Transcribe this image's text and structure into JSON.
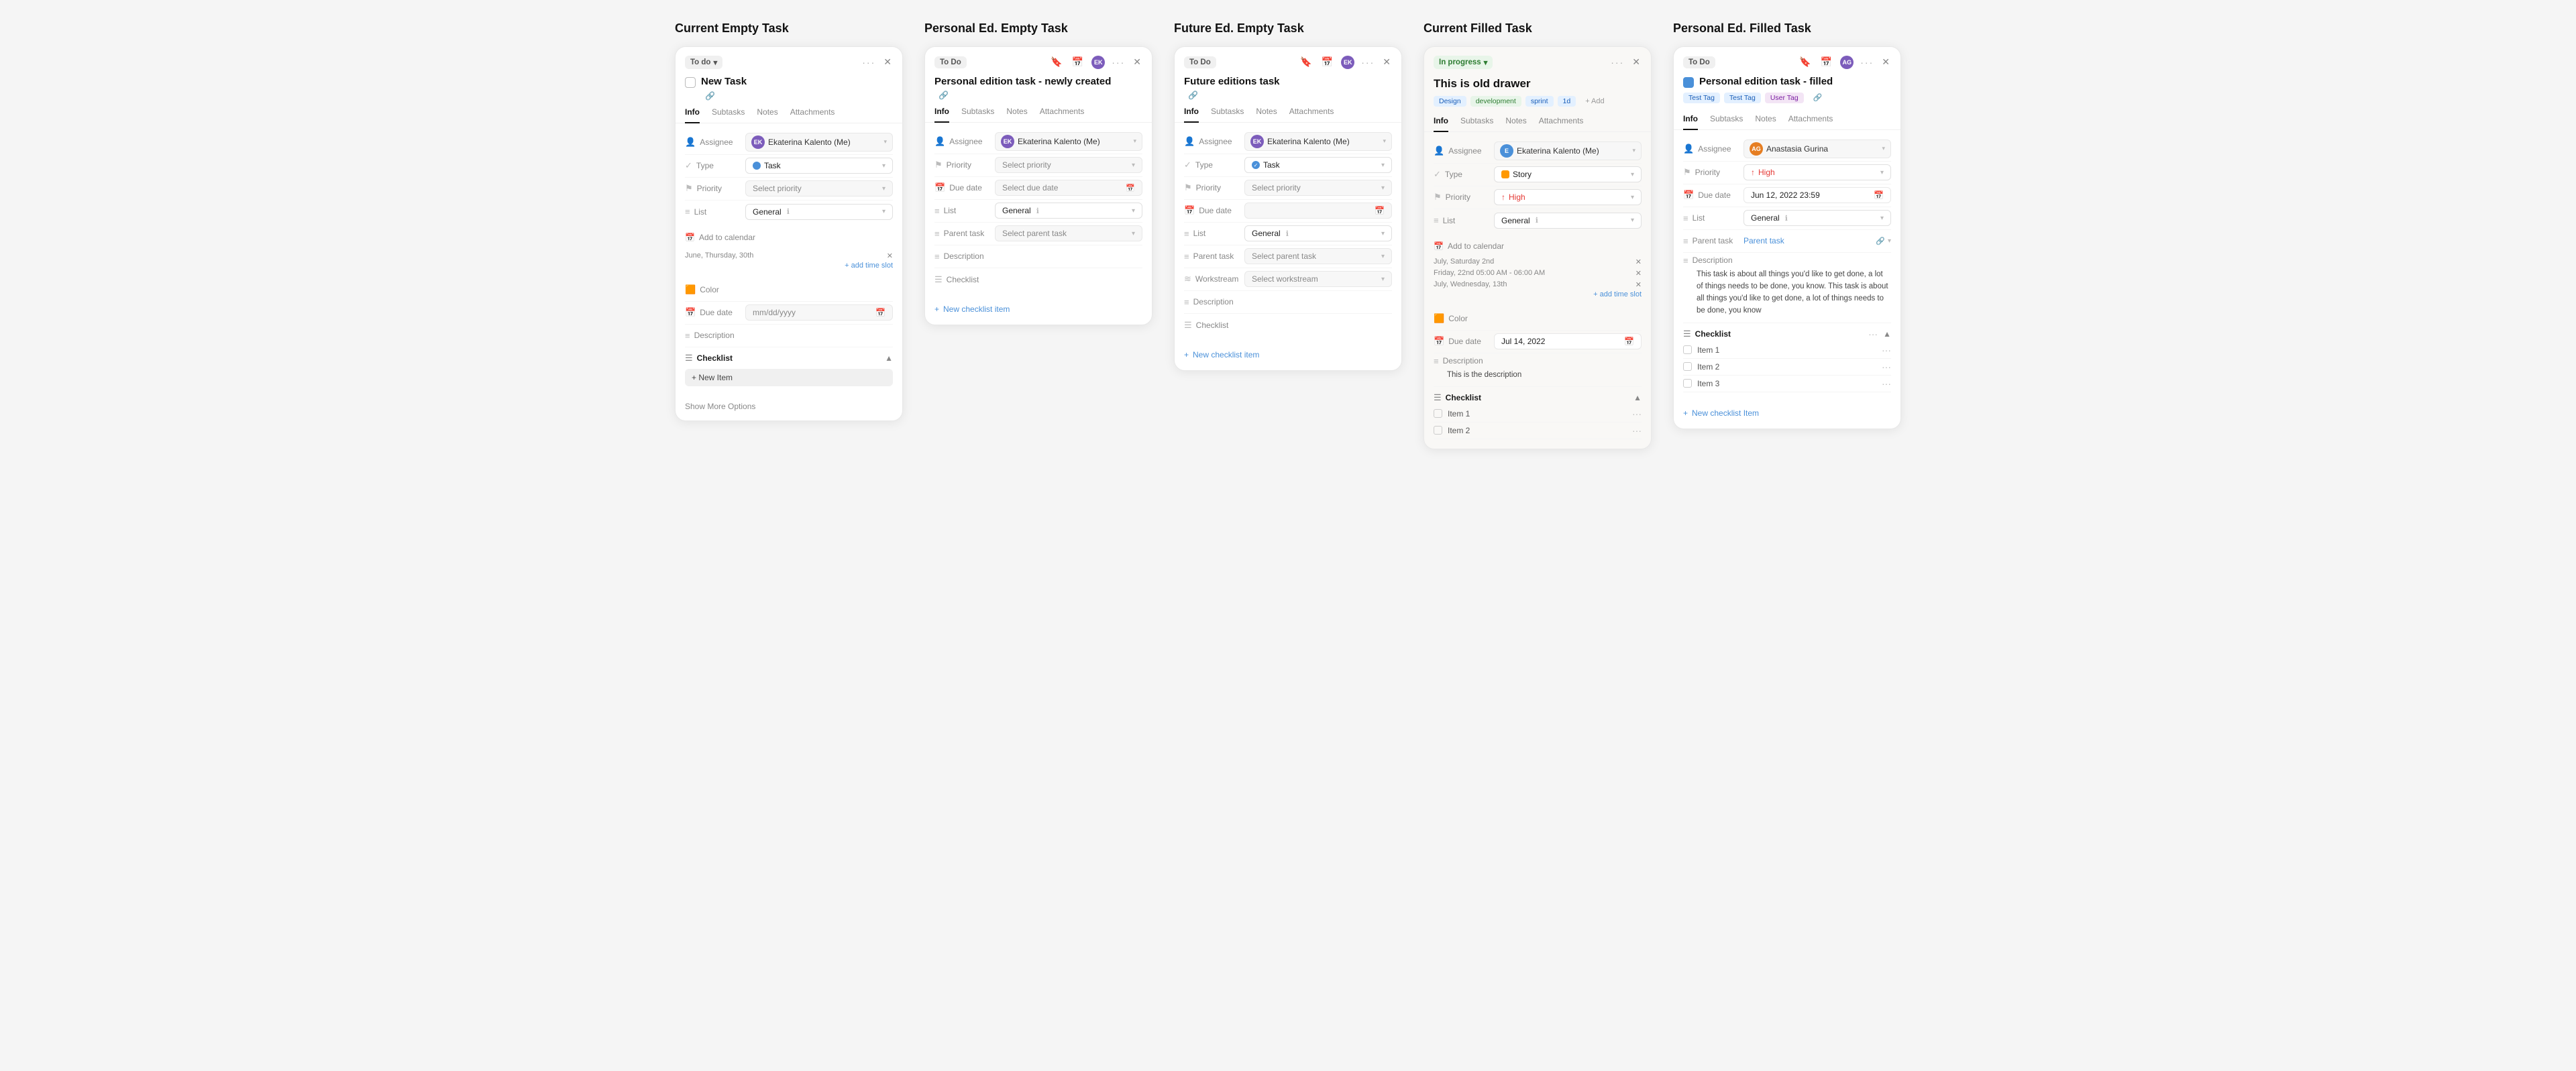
{
  "panels": [
    {
      "id": "current-empty",
      "title": "Current Empty Task",
      "header": {
        "status": "To do",
        "status_type": "todo",
        "status_chevron": "▾",
        "actions": [
          "bookmark",
          "calendar",
          "dots",
          "close"
        ],
        "show_avatar": false
      },
      "task_title": "New Task",
      "task_title_icon": "🔗",
      "tabs": [
        "Info",
        "Subtasks",
        "Notes",
        "Attachments"
      ],
      "active_tab": "Info",
      "fields": [
        {
          "label": "Assignee",
          "icon": "👤",
          "value": "Ekaterina Kalento (Me)",
          "type": "assignee",
          "avatar_color": "#7c5cbb"
        },
        {
          "label": "Type",
          "icon": "✓",
          "value": "Task",
          "type": "type",
          "dot_color": "#4a90d9"
        },
        {
          "label": "Priority",
          "icon": "⚑",
          "value": "Select priority",
          "type": "select-empty"
        },
        {
          "label": "List",
          "icon": "≡",
          "value": "General",
          "type": "list"
        }
      ],
      "show_add_calendar": true,
      "date_section": {
        "show": true,
        "note": "June, Thursday, 30th ✕",
        "add_slot": "+ add time slot"
      },
      "color_row": true,
      "due_date_row": {
        "show": true,
        "placeholder": "mm/dd/yyyy"
      },
      "description_row": true,
      "checklist": {
        "show": true,
        "expanded": true,
        "items": [],
        "new_item": "New Item",
        "show_new_item_filled": true
      },
      "show_more": "Show More Options"
    },
    {
      "id": "personal-empty",
      "title": "Personal Ed. Empty Task",
      "header": {
        "status": "To Do",
        "status_type": "todo",
        "actions": [
          "bookmark",
          "calendar",
          "avatar",
          "dots",
          "close"
        ],
        "show_avatar": true,
        "avatar_color": "#7c5cbb"
      },
      "task_title": "Personal edition task - newly created",
      "task_title_icon": "🔗",
      "tabs": [
        "Info",
        "Subtasks",
        "Notes",
        "Attachments"
      ],
      "active_tab": "Info",
      "fields": [
        {
          "label": "Assignee",
          "icon": "👤",
          "value": "Ekaterina Kalento (Me)",
          "type": "assignee",
          "avatar_color": "#7c5cbb"
        },
        {
          "label": "Priority",
          "icon": "⚑",
          "value": "Select priority",
          "type": "select-empty"
        },
        {
          "label": "Due date",
          "icon": "📅",
          "value": "Select due date",
          "type": "select-empty"
        },
        {
          "label": "List",
          "icon": "≡",
          "value": "General",
          "type": "list"
        },
        {
          "label": "Parent task",
          "icon": "≡",
          "value": "Select parent task",
          "type": "select-empty"
        }
      ],
      "description_row": true,
      "checklist": {
        "show": true,
        "expanded": false,
        "items": [],
        "new_item_label": "New checklist item",
        "show_new_item_filled": false
      }
    },
    {
      "id": "future-empty",
      "title": "Future Ed. Empty Task",
      "header": {
        "status": "To Do",
        "status_type": "todo",
        "actions": [
          "bookmark",
          "calendar",
          "avatar",
          "dots",
          "close"
        ],
        "show_avatar": true,
        "avatar_color": "#7c5cbb"
      },
      "task_title": "Future editions task",
      "task_title_icon": "🔗",
      "tabs": [
        "Info",
        "Subtasks",
        "Notes",
        "Attachments"
      ],
      "active_tab": "Info",
      "fields": [
        {
          "label": "Assignee",
          "icon": "👤",
          "value": "Ekaterina Kalento (Me)",
          "type": "assignee",
          "avatar_color": "#7c5cbb"
        },
        {
          "label": "Type",
          "icon": "✓",
          "value": "Task",
          "type": "type-checked",
          "dot_color": "#4a90d9"
        },
        {
          "label": "Priority",
          "icon": "⚑",
          "value": "Select priority",
          "type": "select-empty"
        },
        {
          "label": "Due date",
          "icon": "📅",
          "value": "",
          "type": "date-empty"
        },
        {
          "label": "List",
          "icon": "≡",
          "value": "General",
          "type": "list"
        },
        {
          "label": "Parent task",
          "icon": "≡",
          "value": "Select parent task",
          "type": "select-empty"
        },
        {
          "label": "Workstream",
          "icon": "≋",
          "value": "Select workstream",
          "type": "select-empty"
        }
      ],
      "description_row": true,
      "checklist": {
        "show": true,
        "expanded": false,
        "items": [],
        "new_item_label": "New checklist item",
        "show_new_item_filled": false
      }
    },
    {
      "id": "current-filled",
      "title": "Current Filled Task",
      "header": {
        "status": "In progress",
        "status_type": "inprogress",
        "status_chevron": "▾",
        "actions": [
          "dots",
          "close"
        ],
        "show_avatar": false
      },
      "drawer_title": "This is old drawer",
      "tags": [
        {
          "label": "Design",
          "color": "blue"
        },
        {
          "label": "development",
          "color": "green"
        },
        {
          "label": "sprint",
          "color": "blue"
        },
        {
          "label": "1d",
          "color": "blue"
        },
        {
          "label": "+ Add",
          "color": "add"
        }
      ],
      "tabs": [
        "Info",
        "Subtasks",
        "Notes",
        "Attachments"
      ],
      "active_tab": "Info",
      "fields": [
        {
          "label": "Assignee",
          "icon": "👤",
          "value": "Ekaterina Kalento (Me)",
          "type": "assignee-e",
          "avatar_color": "#4a90d9"
        },
        {
          "label": "Type",
          "icon": "✓",
          "value": "Story",
          "type": "type-story",
          "dot_color": "#ff9800"
        },
        {
          "label": "Priority",
          "icon": "⚑",
          "value": "High",
          "type": "priority-high"
        },
        {
          "label": "List",
          "icon": "≡",
          "value": "General",
          "type": "list"
        }
      ],
      "show_add_calendar": true,
      "date_section": {
        "show": true,
        "note1": "July, Saturday 2nd ✕",
        "note2": "Friday, 22nd 05:00 AM - 06:00 AM ✕",
        "note3": "July, Wednesday, 13th ✕",
        "add_slot": "+ add time slot"
      },
      "color_row": true,
      "due_date_row": {
        "show": true,
        "value": "Jul 14, 2022",
        "has_calendar_icon": true
      },
      "description_row": true,
      "description_text": "This is the description",
      "checklist": {
        "show": true,
        "expanded": true,
        "items": [
          "Item 1",
          "Item 2"
        ]
      }
    },
    {
      "id": "personal-filled",
      "title": "Personal Ed. Filled Task",
      "header": {
        "status": "To Do",
        "status_type": "todo",
        "actions": [
          "bookmark",
          "calendar",
          "avatar",
          "dots",
          "close"
        ],
        "show_avatar": true,
        "avatar_color": "#7c5cbb"
      },
      "task_title": "Personal edition task - filled",
      "task_title_icon": "🔗",
      "tags": [
        {
          "label": "Test Tag",
          "color": "blue"
        },
        {
          "label": "Test Tag",
          "color": "blue"
        },
        {
          "label": "User Tag",
          "color": "purple"
        },
        {
          "label": "🔗",
          "color": "add"
        }
      ],
      "tabs": [
        "Info",
        "Subtasks",
        "Notes",
        "Attachments"
      ],
      "active_tab": "Info",
      "fields": [
        {
          "label": "Assignee",
          "icon": "👤",
          "value": "Anastasia Gurina",
          "type": "assignee",
          "avatar_color": "#e67e22"
        },
        {
          "label": "Priority",
          "icon": "⚑",
          "value": "High",
          "type": "priority-high"
        },
        {
          "label": "Due date",
          "icon": "📅",
          "value": "Jun 12, 2022 23:59",
          "type": "date-filled"
        },
        {
          "label": "List",
          "icon": "≡",
          "value": "General",
          "type": "list"
        },
        {
          "label": "Parent task",
          "icon": "≡",
          "value": "Parent task",
          "type": "parent-task-link"
        }
      ],
      "description_row": true,
      "description_text": "This task is about all things you'd like to get done, a lot of things needs to be done, you know. This task is about all things you'd like to get done, a lot of things needs to be done, you know",
      "checklist": {
        "show": true,
        "expanded": true,
        "items": [
          "Item 1",
          "Item 2",
          "Item 3"
        ],
        "new_item_label": "New checklist Item"
      }
    }
  ],
  "labels": {
    "assignee": "Assignee",
    "type": "Type",
    "priority": "Priority",
    "list": "List",
    "due_date": "Due date",
    "parent_task": "Parent task",
    "description": "Description",
    "checklist": "Checklist",
    "workstream": "Workstream",
    "color": "Color",
    "add_calendar": "Add to calendar",
    "show_more": "Show More Options",
    "new_item": "+ New Item",
    "new_checklist": "+ New checklist item",
    "general": "General",
    "select_priority": "Select priority",
    "select_due_date": "Select due date",
    "select_parent": "Select parent task",
    "select_workstream": "Select workstream",
    "task": "Task",
    "story": "Story",
    "high": "High"
  }
}
